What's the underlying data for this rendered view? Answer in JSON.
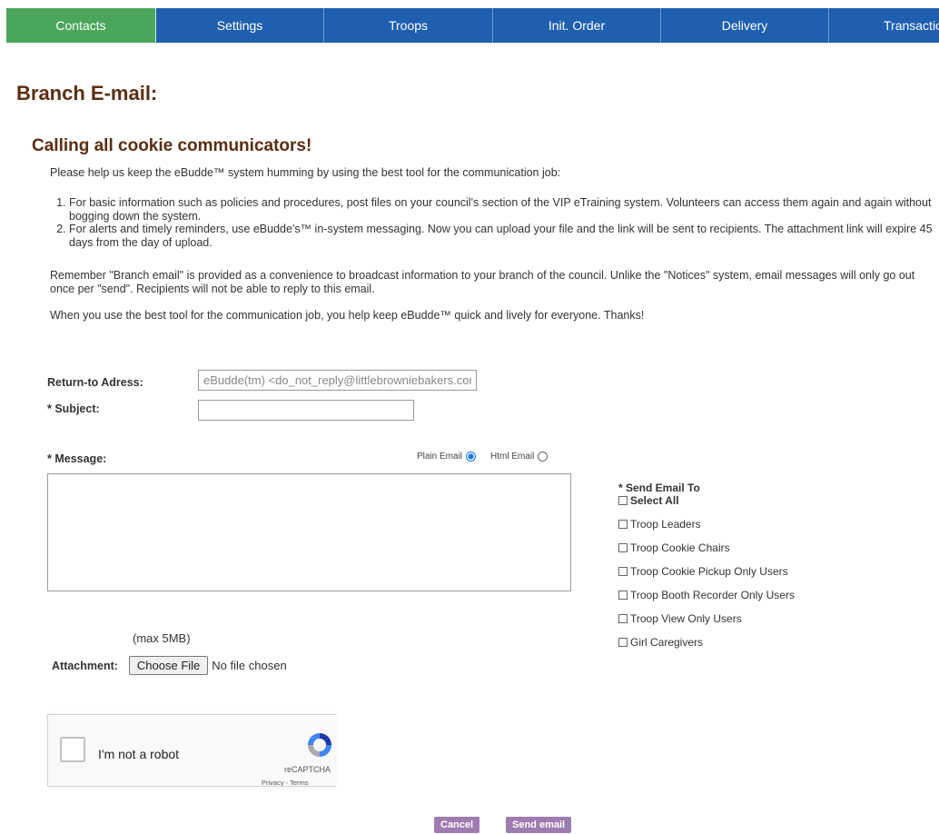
{
  "nav": {
    "tabs": [
      {
        "label": "Contacts",
        "active": true
      },
      {
        "label": "Settings",
        "active": false
      },
      {
        "label": "Troops",
        "active": false
      },
      {
        "label": "Init. Order",
        "active": false
      },
      {
        "label": "Delivery",
        "active": false
      },
      {
        "label": "Transactions",
        "active": false
      }
    ]
  },
  "page": {
    "title": "Branch E-mail:",
    "heading": "Calling all cookie communicators!",
    "intro": "Please help us keep the eBudde™ system humming by using the best tool for the communication job:",
    "list": [
      "For basic information such as policies and procedures, post files on your council's section of the VIP eTraining system. Volunteers can access them again and again without bogging down the system.",
      "For alerts and timely reminders, use eBudde's™ in-system messaging. Now you can upload your file and the link will be sent to recipients. The attachment link will expire 45 days from the day of upload."
    ],
    "remember": "Remember \"Branch email\" is provided as a convenience to broadcast information to your branch of the council. Unlike the \"Notices\" system, email messages will only go out once per \"send\". Recipients will not be able to reply to this email.",
    "closing": "When you use the best tool for the communication job, you help keep eBudde™ quick and lively for everyone. Thanks!"
  },
  "form": {
    "return_label": "Return-to Adress:",
    "return_placeholder": "eBudde(tm) <do_not_reply@littlebrowniebakers.com>",
    "subject_label": "* Subject:",
    "subject_value": "",
    "message_label": "* Message:",
    "plain_email_label": "Plain Email",
    "html_email_label": "Html Email",
    "email_format": "plain",
    "max_size": "(max 5MB)",
    "attachment_label": "Attachment:",
    "choose_file_label": "Choose File",
    "no_file_text": "No file chosen"
  },
  "send_to": {
    "heading": "* Send Email To",
    "select_all": "Select All",
    "options": [
      "Troop Leaders",
      "Troop Cookie Chairs",
      "Troop Cookie Pickup Only Users",
      "Troop Booth Recorder Only Users",
      "Troop View Only Users",
      "Girl Caregivers"
    ]
  },
  "captcha": {
    "label": "I'm not a robot",
    "brand": "reCAPTCHA",
    "links": "Privacy - Terms"
  },
  "actions": {
    "cancel": "Cancel",
    "send": "Send email"
  },
  "colors": {
    "nav_bg": "#1f5fb0",
    "nav_active": "#4aa65a",
    "heading": "#5b2d10",
    "button": "#9f7cb0"
  }
}
